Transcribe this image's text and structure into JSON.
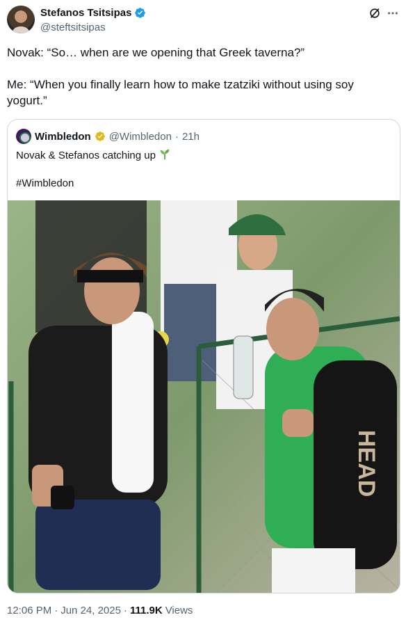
{
  "author": {
    "display_name": "Stefanos Tsitsipas",
    "handle": "@steftsitsipas",
    "verified_color": "#1d9bf0"
  },
  "tweet": {
    "line1": "Novak: “So… when are we opening that Greek taverna?”",
    "line2": "Me: “When you finally learn how to make tzatziki without using soy yogurt.”"
  },
  "quote": {
    "display_name": "Wimbledon",
    "handle": "@Wimbledon",
    "separator": "·",
    "time": "21h",
    "verified_color": "#e2b719",
    "text": "Novak & Stefanos catching up",
    "hashtag": "#Wimbledon",
    "photo_icon": "photo-two-tennis-players"
  },
  "meta": {
    "time": "12:06 PM",
    "sep1": "·",
    "date": "Jun 24, 2025",
    "sep2": "·",
    "views": "111.9K",
    "views_label": "Views"
  },
  "icons": {
    "grok": "grok-icon",
    "more": "more-icon",
    "seedling": "seedling-icon"
  }
}
